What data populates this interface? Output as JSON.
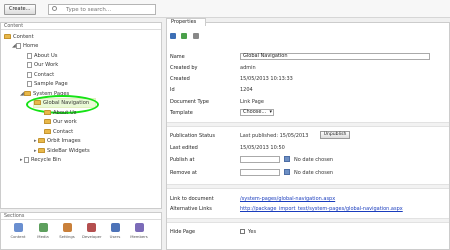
{
  "toolbar": {
    "create_label": "Create...",
    "search_placeholder": "Type to search..."
  },
  "content_panel": {
    "title": "Content",
    "tree": [
      {
        "label": "Content",
        "kind": "folder"
      },
      {
        "label": "Home",
        "kind": "page"
      },
      {
        "label": "About Us",
        "kind": "page"
      },
      {
        "label": "Our Work",
        "kind": "page"
      },
      {
        "label": "Contact",
        "kind": "page"
      },
      {
        "label": "Sample Page",
        "kind": "page"
      },
      {
        "label": "System Pages",
        "kind": "folder"
      },
      {
        "label": "Global Navigation",
        "kind": "folder",
        "selected": true
      },
      {
        "label": "About Us",
        "kind": "folder"
      },
      {
        "label": "Our work",
        "kind": "folder"
      },
      {
        "label": "Contact",
        "kind": "folder"
      },
      {
        "label": "Orbit Images",
        "kind": "folder"
      },
      {
        "label": "SideBar Widgets",
        "kind": "folder"
      },
      {
        "label": "Recycle Bin",
        "kind": "page"
      }
    ]
  },
  "sections_panel": {
    "title": "Sections",
    "items": [
      {
        "label": "Content",
        "color": "#6a8fd0"
      },
      {
        "label": "Media",
        "color": "#5d9f5d"
      },
      {
        "label": "Settings",
        "color": "#c9803a"
      },
      {
        "label": "Developer",
        "color": "#b44f4f"
      },
      {
        "label": "Users",
        "color": "#4d73b8"
      },
      {
        "label": "Members",
        "color": "#7b6bb8"
      }
    ]
  },
  "properties": {
    "tab_label": "Properties",
    "name_label": "Name",
    "name_value": "Global Navigation",
    "created_by_label": "Created by",
    "created_by_value": "admin",
    "created_label": "Created",
    "created_value": "15/05/2013 10:13:33",
    "id_label": "Id",
    "id_value": "1204",
    "doctype_label": "Document Type",
    "doctype_value": "Link Page",
    "template_label": "Template",
    "template_value": "Choose...",
    "pub_status_label": "Publication Status",
    "pub_status_value": "Last published: 15/05/2013",
    "unpublish_label": "Unpublish",
    "last_edited_label": "Last edited",
    "last_edited_value": "15/05/2013 10:50",
    "publish_at_label": "Publish at",
    "publish_at_value": "No date chosen",
    "remove_at_label": "Remove at",
    "remove_at_value": "No date chosen",
    "link_label": "Link to document",
    "link_value": "/system-pages/global-navigation.aspx",
    "alt_links_label": "Alternative Links",
    "alt_links_value": "http://package_import_test/system-pages/global-navigation.aspx",
    "hide_page_label": "Hide Page",
    "hide_page_value": "Yes"
  }
}
